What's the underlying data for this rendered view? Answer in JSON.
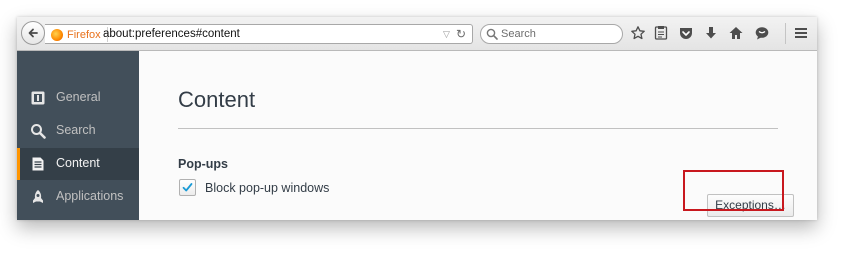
{
  "browser": {
    "identity_label": "Firefox",
    "url": "about:preferences#content",
    "search_placeholder": "Search",
    "toolbar_icons": [
      "bookmark-star-icon",
      "reading-list-icon",
      "pocket-icon",
      "download-icon",
      "home-icon",
      "chat-icon",
      "menu-icon"
    ]
  },
  "sidebar": {
    "items": [
      {
        "label": "General",
        "icon": "general-icon"
      },
      {
        "label": "Search",
        "icon": "search-icon"
      },
      {
        "label": "Content",
        "icon": "content-icon",
        "active": true
      },
      {
        "label": "Applications",
        "icon": "applications-icon"
      }
    ]
  },
  "main": {
    "title": "Content",
    "popups": {
      "heading": "Pop-ups",
      "block_label": "Block pop-up windows",
      "block_checked": true,
      "exceptions_label": "Exceptions…"
    }
  },
  "colors": {
    "sidebar_bg": "#424f5a",
    "sidebar_active_bg": "#343f48",
    "active_accent": "#ff9500",
    "highlight": "#c8181e",
    "check": "#1a9bd6"
  }
}
